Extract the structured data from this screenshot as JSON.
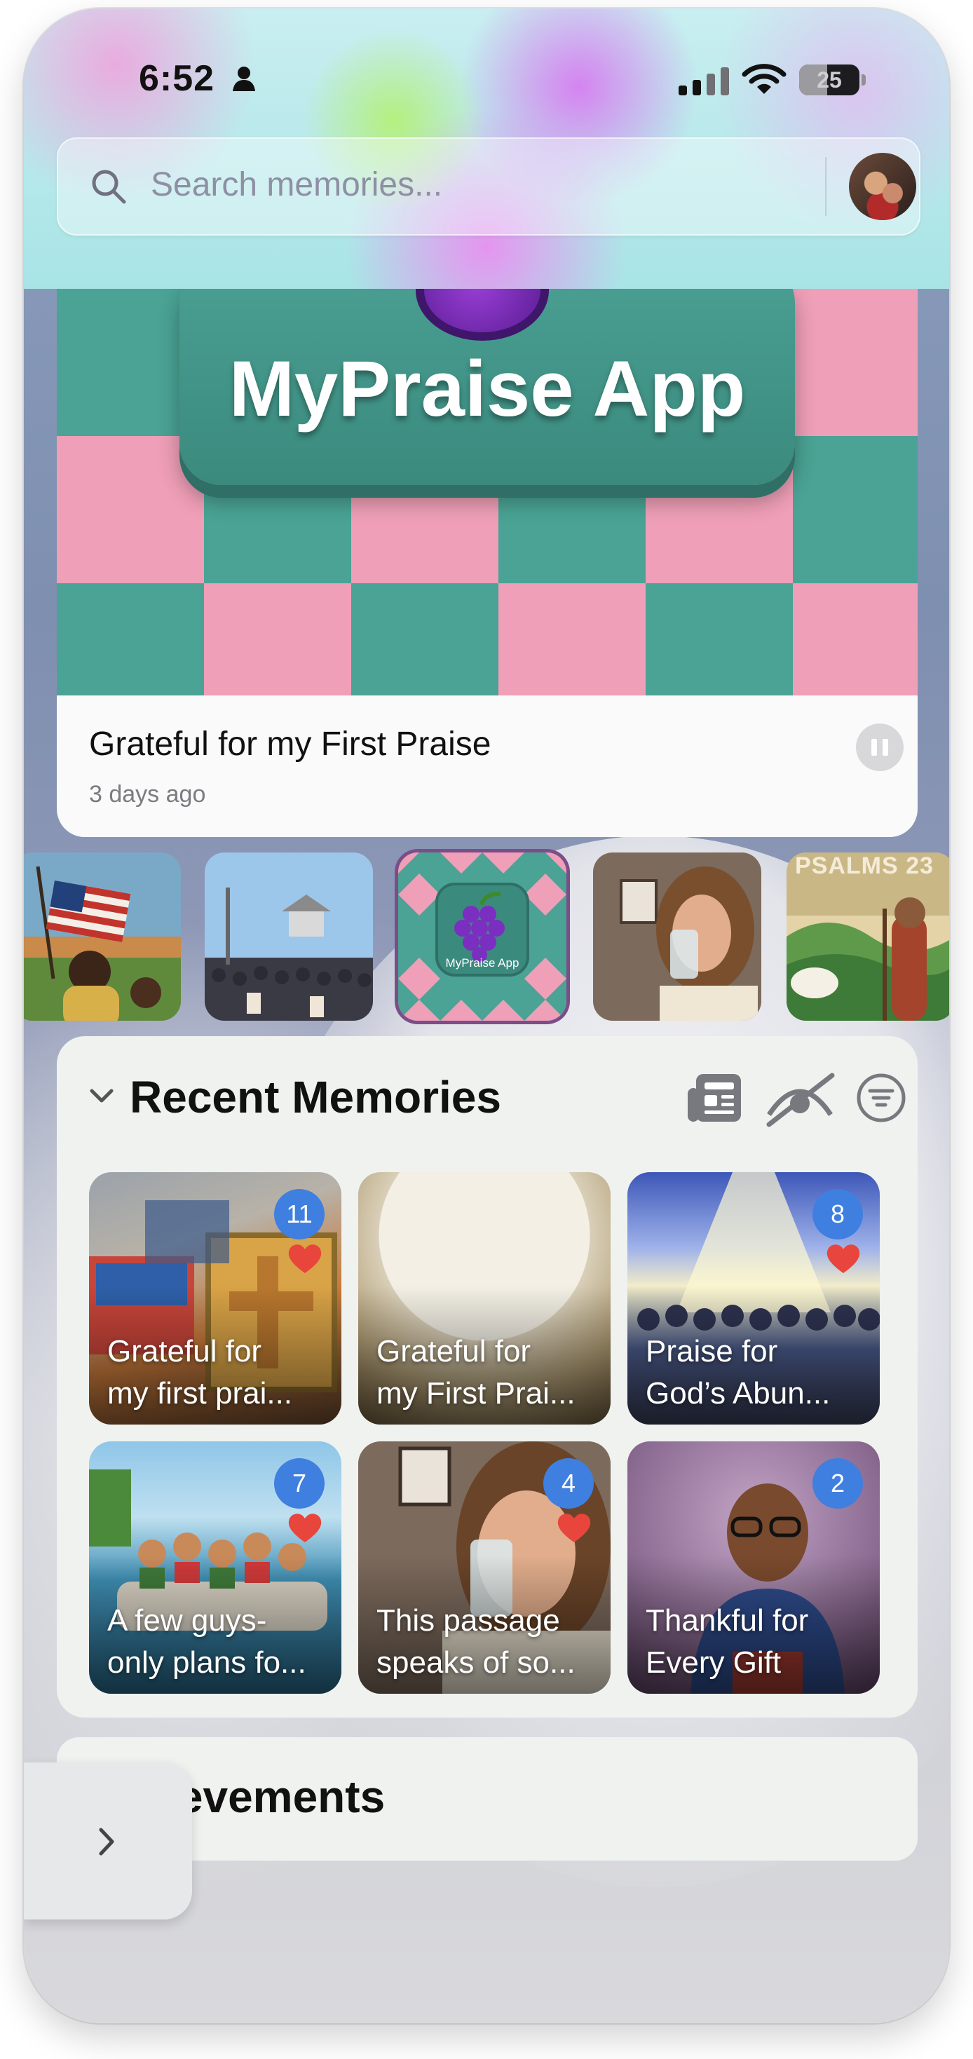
{
  "status_bar": {
    "time": "6:52",
    "battery": "25"
  },
  "search": {
    "placeholder": "Search memories..."
  },
  "featured": {
    "art_text": "MyPraise App",
    "title": "Grateful for my First Praise",
    "time_ago": "3 days ago"
  },
  "thumbnails": {
    "selected_app_label": "MyPraise App",
    "psalm_text": "PSALMS 23"
  },
  "recent_memories": {
    "title": "Recent Memories",
    "items": [
      {
        "label": "Grateful for\nmy first prai...",
        "count": "11",
        "liked": true
      },
      {
        "label": "Grateful for\nmy First Prai...",
        "count": "",
        "liked": false
      },
      {
        "label": "Praise for\nGod’s Abun...",
        "count": "8",
        "liked": true
      },
      {
        "label": "A few guys-\nonly plans fo...",
        "count": "7",
        "liked": true
      },
      {
        "label": "This passage\nspeaks of so...",
        "count": "4",
        "liked": true
      },
      {
        "label": "Thankful for\nEvery Gift",
        "count": "2",
        "liked": false
      }
    ]
  },
  "achievements": {
    "title_visible": "hievements"
  },
  "colors": {
    "accent_badge": "#3f7fe0",
    "heart": "#e8453c",
    "pink": "#ef9fb7",
    "teal": "#4aa394"
  }
}
